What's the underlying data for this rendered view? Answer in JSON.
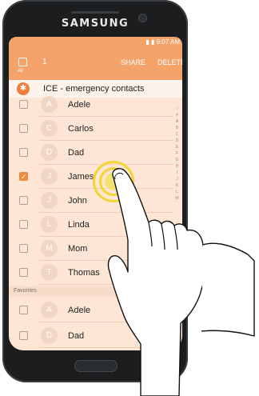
{
  "device": {
    "brand": "SAMSUNG"
  },
  "status_bar": {
    "time": "9:07 AM"
  },
  "action_bar": {
    "all_label": "All",
    "selected_count": "1",
    "share": "SHARE",
    "delete": "DELETE"
  },
  "ice": {
    "label": "ICE - emergency contacts"
  },
  "contacts": [
    {
      "initial": "A",
      "name": "Adele",
      "checked": false
    },
    {
      "initial": "C",
      "name": "Carlos",
      "checked": false
    },
    {
      "initial": "D",
      "name": "Dad",
      "checked": false
    },
    {
      "initial": "J",
      "name": "James",
      "checked": true
    },
    {
      "initial": "J",
      "name": "John",
      "checked": false
    },
    {
      "initial": "L",
      "name": "Linda",
      "checked": false
    },
    {
      "initial": "M",
      "name": "Mom",
      "checked": false
    },
    {
      "initial": "T",
      "name": "Thomas",
      "checked": false
    }
  ],
  "favorites": {
    "header": "Favorites",
    "items": [
      {
        "initial": "A",
        "name": "Adele",
        "checked": false
      },
      {
        "initial": "D",
        "name": "Dad",
        "checked": false
      }
    ]
  },
  "index_letters": [
    "☆",
    "#",
    "A",
    "B",
    "C",
    "D",
    "E",
    "F",
    "G",
    "H",
    "I",
    "J",
    "K",
    "L",
    "M"
  ],
  "colors": {
    "accent": "#f4a36a",
    "screen_bg": "#fde6d5",
    "ripple": "#f1d531",
    "ice_icon": "#f07d3c"
  }
}
